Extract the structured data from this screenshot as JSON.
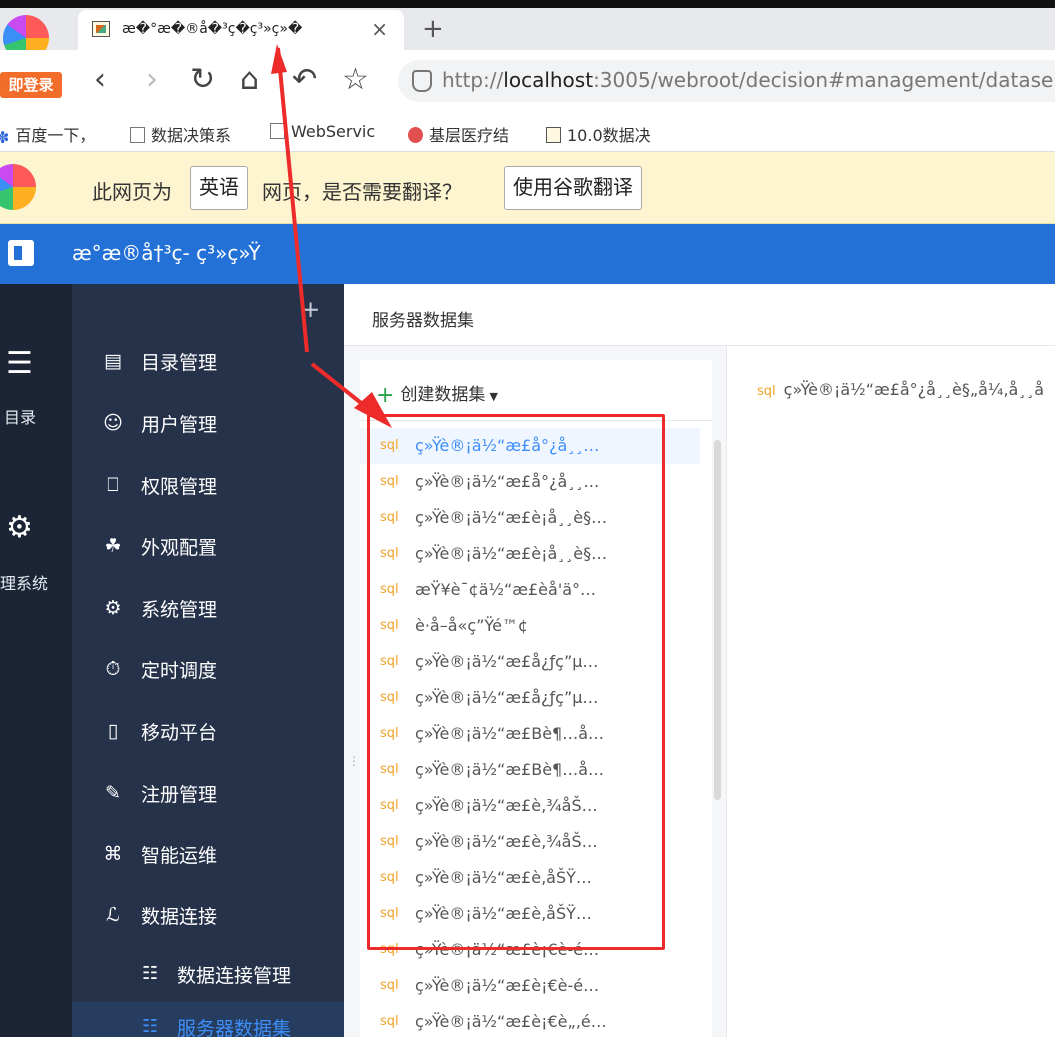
{
  "browser": {
    "tab_title": "æ�°æ�®å�³ç�ç³»ç»�",
    "tab_close": "×",
    "new_tab": "+",
    "login_badge": "即登录",
    "url_prefix": "http://",
    "url_host": "localhost",
    "url_rest": ":3005/webroot/decision#management/datase",
    "bookmarks": [
      "百度一下，",
      "数据决策系",
      "WebServic",
      "基层医疗结",
      "10.0数据决"
    ],
    "translate": {
      "text1": "此网页为",
      "lang_button": "英语",
      "text2": "网页，是否需要翻译？",
      "translate_button": "使用谷歌翻译"
    }
  },
  "app": {
    "title": "æ°æ®å†³ç- ç³»ç»Ÿ",
    "rail": [
      {
        "icon": "list-icon",
        "label": "目录"
      },
      {
        "icon": "gear-icon",
        "label": "管理系统"
      }
    ],
    "menu": [
      {
        "icon": "catalog-icon",
        "label": "目录管理"
      },
      {
        "icon": "user-icon",
        "label": "用户管理"
      },
      {
        "icon": "lock-icon",
        "label": "权限管理"
      },
      {
        "icon": "paint-roller-icon",
        "label": "外观配置"
      },
      {
        "icon": "settings-icon",
        "label": "系统管理"
      },
      {
        "icon": "timer-icon",
        "label": "定时调度"
      },
      {
        "icon": "mobile-icon",
        "label": "移动平台"
      },
      {
        "icon": "register-icon",
        "label": "注册管理"
      },
      {
        "icon": "ops-icon",
        "label": "智能运维"
      },
      {
        "icon": "link-icon",
        "label": "数据连接"
      }
    ],
    "submenu": [
      {
        "icon": "db-connection-icon",
        "label": "数据连接管理"
      },
      {
        "icon": "server-dataset-icon",
        "label": "服务器数据集"
      }
    ],
    "breadcrumb": "服务器数据集",
    "create_button": "创建数据集",
    "sql_tag": "sql",
    "datasets": [
      "ç»Ÿè®¡ä½“æ£å°¿å¸¸…",
      "ç»Ÿè®¡ä½“æ£å°¿å¸¸…",
      "ç»Ÿè®¡ä½“æ£è¡å¸¸è§…",
      "ç»Ÿè®¡ä½“æ£è¡å¸¸è§…",
      "æŸ¥è¯¢ä½“æ£èå'ä°…",
      "è·å–å«ç”Ÿé™¢",
      "ç»Ÿè®¡ä½“æ£å¿ƒç”µ…",
      "ç»Ÿè®¡ä½“æ£å¿ƒç”µ…",
      "ç»Ÿè®¡ä½“æ£Bè¶…å…",
      "ç»Ÿè®¡ä½“æ£Bè¶…å…",
      "ç»Ÿè®¡ä½“æ£è‚¾åŠ…",
      "ç»Ÿè®¡ä½“æ£è‚¾åŠ…",
      "ç»Ÿè®¡ä½“æ£è‚åŠŸ…",
      "ç»Ÿè®¡ä½“æ£è‚åŠŸ…",
      "ç»Ÿè®¡ä½“æ£è¡€è-é…",
      "ç»Ÿè®¡ä½“æ£è¡€è-é…",
      "ç»Ÿè®¡ä½“æ£è¡€è„‚é…"
    ],
    "detail_title": "ç»Ÿè®¡ä½“æ£å°¿å¸¸è§„å¼‚å¸¸å"
  },
  "colors": {
    "header_blue": "#2371d6",
    "sidebar_bg": "#25324a",
    "rail_bg": "#1b2536",
    "active_blue": "#3d8ef8",
    "sql_orange": "#f2a227",
    "annotation_red": "#ee2b2b"
  }
}
